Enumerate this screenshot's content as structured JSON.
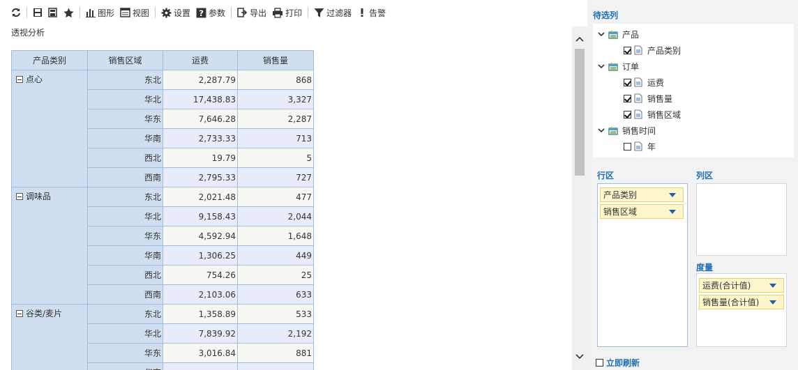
{
  "toolbar": {
    "items": [
      {
        "icon": "refresh-icon",
        "label": ""
      },
      {
        "icon": "save-icon",
        "label": ""
      },
      {
        "icon": "save-as-icon",
        "label": ""
      },
      {
        "icon": "star-icon",
        "label": ""
      },
      {
        "icon": "chart-icon",
        "label": "图形"
      },
      {
        "icon": "view-icon",
        "label": "视图"
      },
      {
        "icon": "gear-icon",
        "label": "设置"
      },
      {
        "icon": "param-icon",
        "label": "参数"
      },
      {
        "icon": "export-icon",
        "label": "导出"
      },
      {
        "icon": "print-icon",
        "label": "打印"
      },
      {
        "icon": "filter-icon",
        "label": "过滤器"
      },
      {
        "icon": "alert-icon",
        "label": "告警"
      }
    ]
  },
  "page_title": "透视分析",
  "table": {
    "headers": [
      "产品类别",
      "销售区域",
      "运费",
      "销售量"
    ],
    "groups": [
      {
        "category": "点心",
        "rows": [
          {
            "region": "东北",
            "freight": "2,287.79",
            "qty": "868"
          },
          {
            "region": "华北",
            "freight": "17,438.83",
            "qty": "3,327"
          },
          {
            "region": "华东",
            "freight": "7,646.28",
            "qty": "2,287"
          },
          {
            "region": "华南",
            "freight": "2,733.33",
            "qty": "713"
          },
          {
            "region": "西北",
            "freight": "19.79",
            "qty": "5"
          },
          {
            "region": "西南",
            "freight": "2,795.33",
            "qty": "727"
          }
        ]
      },
      {
        "category": "调味品",
        "rows": [
          {
            "region": "东北",
            "freight": "2,021.48",
            "qty": "477"
          },
          {
            "region": "华北",
            "freight": "9,158.43",
            "qty": "2,044"
          },
          {
            "region": "华东",
            "freight": "4,592.94",
            "qty": "1,648"
          },
          {
            "region": "华南",
            "freight": "1,306.25",
            "qty": "449"
          },
          {
            "region": "西北",
            "freight": "754.26",
            "qty": "25"
          },
          {
            "region": "西南",
            "freight": "2,103.06",
            "qty": "633"
          }
        ]
      },
      {
        "category": "谷类/麦片",
        "rows": [
          {
            "region": "东北",
            "freight": "1,358.89",
            "qty": "533"
          },
          {
            "region": "华北",
            "freight": "7,839.92",
            "qty": "2,192"
          },
          {
            "region": "华东",
            "freight": "3,016.84",
            "qty": "881"
          },
          {
            "region": "华南",
            "freight": "",
            "qty": ""
          }
        ]
      }
    ]
  },
  "panel": {
    "candidates_title": "待选列",
    "tree": [
      {
        "label": "产品",
        "type": "folder",
        "level": 0,
        "expanded": true
      },
      {
        "label": "产品类别",
        "type": "field",
        "level": 1,
        "checked": true
      },
      {
        "label": "订单",
        "type": "folder",
        "level": 0,
        "expanded": true
      },
      {
        "label": "运费",
        "type": "field",
        "level": 1,
        "checked": true
      },
      {
        "label": "销售量",
        "type": "field",
        "level": 1,
        "checked": true
      },
      {
        "label": "销售区域",
        "type": "field",
        "level": 1,
        "checked": true
      },
      {
        "label": "销售时间",
        "type": "folder",
        "level": 0,
        "expanded": true
      },
      {
        "label": "年",
        "type": "field",
        "level": 1,
        "checked": false
      }
    ],
    "rows_title": "行区",
    "cols_title": "列区",
    "measures_title": "度量",
    "row_fields": [
      "产品类别",
      "销售区域"
    ],
    "measure_fields": [
      "运费(合计值)",
      "销售量(合计值)"
    ],
    "refresh_label": "立即刷新"
  },
  "colors": {
    "accent": "#1f6fb5",
    "header_bg": "#cfdff0",
    "chip_bg": "#fdf6cc"
  }
}
